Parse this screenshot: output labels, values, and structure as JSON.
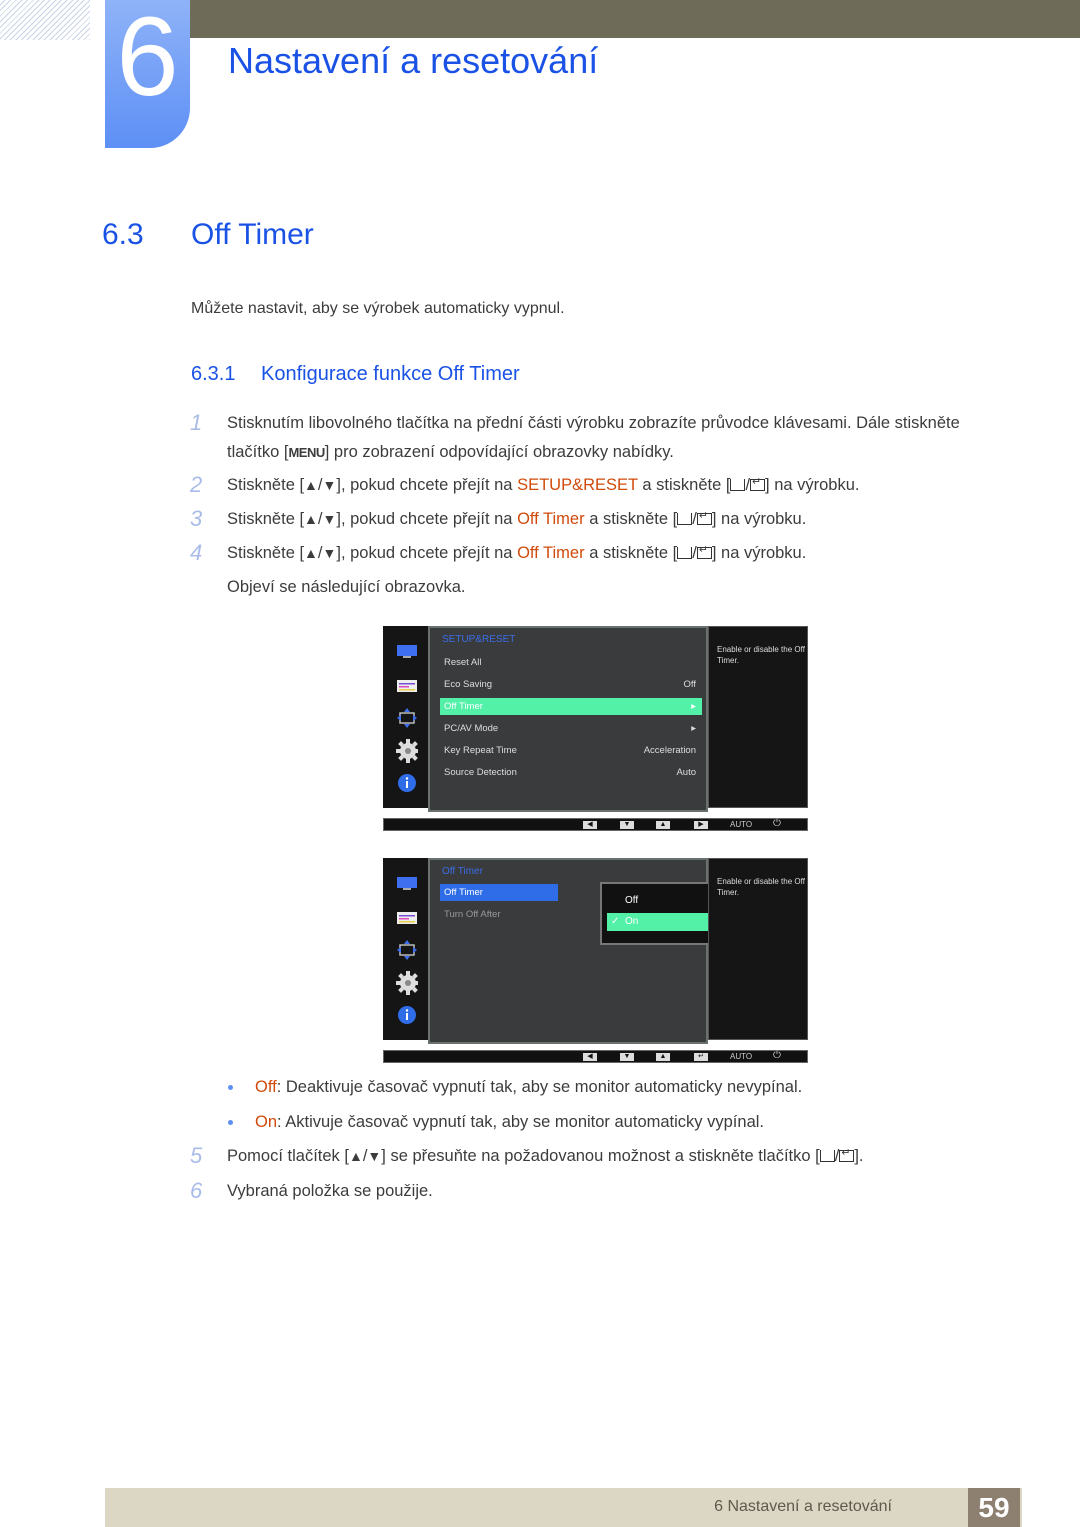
{
  "chapter": {
    "number": "6",
    "title": "Nastavení a resetování"
  },
  "section": {
    "number": "6.3",
    "title": "Off Timer",
    "intro": "Můžete nastavit, aby se výrobek automaticky vypnul."
  },
  "subsection": {
    "number": "6.3.1",
    "title": "Konfigurace funkce Off Timer"
  },
  "steps": [
    {
      "n": "1",
      "line1": "Stisknutím libovolného tlačítka na přední části výrobku zobrazíte průvodce klávesami. Dále stiskněte",
      "line2_a": "tlačítko [",
      "menu_key": "MENU",
      "line2_b": "] pro zobrazení odpovídající obrazovky nabídky."
    },
    {
      "n": "2",
      "a": "Stiskněte [",
      "b": "], pokud chcete přejít na ",
      "target": "SETUP&RESET",
      "c": " a stiskněte [",
      "d": "] na výrobku."
    },
    {
      "n": "3",
      "a": "Stiskněte [",
      "b": "], pokud chcete přejít na ",
      "target": "Off Timer",
      "c": " a stiskněte [",
      "d": "] na výrobku."
    },
    {
      "n": "4",
      "a": "Stiskněte [",
      "b": "], pokud chcete přejít na ",
      "target": "Off Timer",
      "c": " a stiskněte [",
      "d": "] na výrobku.",
      "after": "Objeví se následující obrazovka."
    },
    {
      "n": "5",
      "a": "Pomocí tlačítek [",
      "b": "] se přesuňte na požadovanou možnost a stiskněte tlačítko [",
      "c": "]."
    },
    {
      "n": "6",
      "a": "Vybraná položka se použije."
    }
  ],
  "keys": {
    "up": "▲",
    "slash": "/",
    "down": "▼"
  },
  "osd1": {
    "title": "SETUP&RESET",
    "rows": [
      {
        "label": "Reset All",
        "value": ""
      },
      {
        "label": "Eco Saving",
        "value": "Off"
      },
      {
        "label": "Off Timer",
        "value": "▸",
        "selected": true
      },
      {
        "label": "PC/AV Mode",
        "value": "▸"
      },
      {
        "label": "Key Repeat Time",
        "value": "Acceleration"
      },
      {
        "label": "Source Detection",
        "value": "Auto"
      }
    ],
    "help": "Enable or disable the Off Timer.",
    "bar": {
      "left": "◀",
      "down": "▼",
      "up": "▲",
      "right": "▶",
      "auto": "AUTO",
      "power": "⏻"
    }
  },
  "osd2": {
    "title": "Off Timer",
    "rows": [
      {
        "label": "Off Timer",
        "selected": true
      },
      {
        "label": "Turn Off After"
      }
    ],
    "popup": [
      {
        "label": "Off"
      },
      {
        "label": "On",
        "selected": true,
        "check": "✓"
      }
    ],
    "help": "Enable or disable the Off Timer.",
    "bar": {
      "left": "◀",
      "down": "▼",
      "up": "▲",
      "enter": "↵",
      "auto": "AUTO",
      "power": "⏻"
    }
  },
  "bullets": [
    {
      "key": "Off",
      "text": ": Deaktivuje časovač vypnutí tak, aby se monitor automaticky nevypínal."
    },
    {
      "key": "On",
      "text": ": Aktivuje časovač vypnutí tak, aby se monitor automaticky vypínal."
    }
  ],
  "footer": {
    "text": "6 Nastavení a resetování",
    "page": "59"
  }
}
